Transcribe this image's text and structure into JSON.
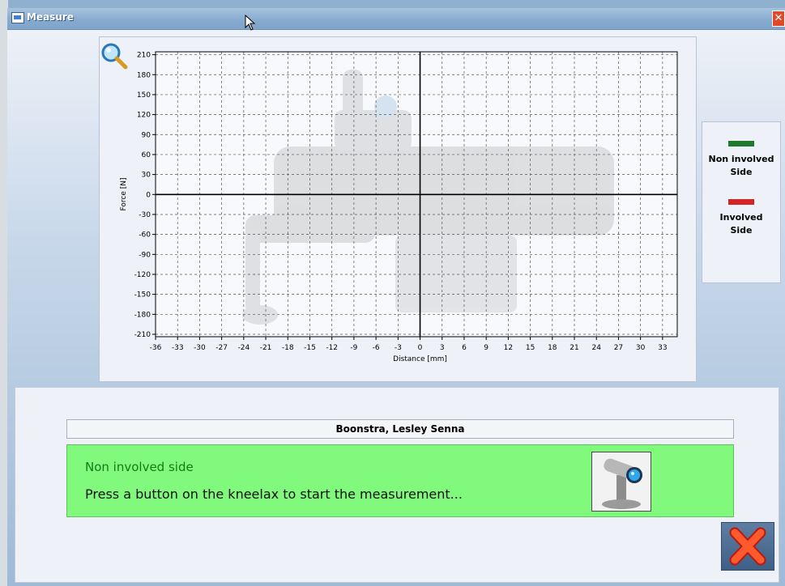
{
  "window": {
    "title": "Measure",
    "close_glyph": "✕"
  },
  "chart_data": {
    "type": "scatter",
    "xlabel": "Distance [mm]",
    "ylabel": "Force [N]",
    "xlim": [
      -36,
      33
    ],
    "ylim": [
      -210,
      210
    ],
    "x_ticks": [
      -36,
      -33,
      -30,
      -27,
      -24,
      -21,
      -18,
      -15,
      -12,
      -9,
      -6,
      -3,
      0,
      3,
      6,
      9,
      12,
      15,
      18,
      21,
      24,
      27,
      30,
      33
    ],
    "y_ticks": [
      210,
      180,
      150,
      120,
      90,
      60,
      30,
      0,
      -30,
      -60,
      -90,
      -120,
      -150,
      -180,
      -210
    ],
    "grid": true,
    "series": [
      {
        "name": "Non involved Side",
        "color": "#1e7a2a",
        "values": []
      },
      {
        "name": "Involved Side",
        "color": "#d42424",
        "values": []
      }
    ]
  },
  "legend": {
    "items": [
      {
        "label_line1": "Non involved",
        "label_line2": "Side",
        "color": "#1e7a2a"
      },
      {
        "label_line1": "Involved",
        "label_line2": "Side",
        "color": "#d42424"
      }
    ]
  },
  "patient": {
    "name": "Boonstra, Lesley Senna"
  },
  "status": {
    "title": "Non involved side",
    "message": "Press a button on the kneelax to start the measurement..."
  },
  "icons": {
    "zoom": "magnifier-icon",
    "device": "kneelax-device-icon",
    "exit": "red-x-close-icon"
  }
}
